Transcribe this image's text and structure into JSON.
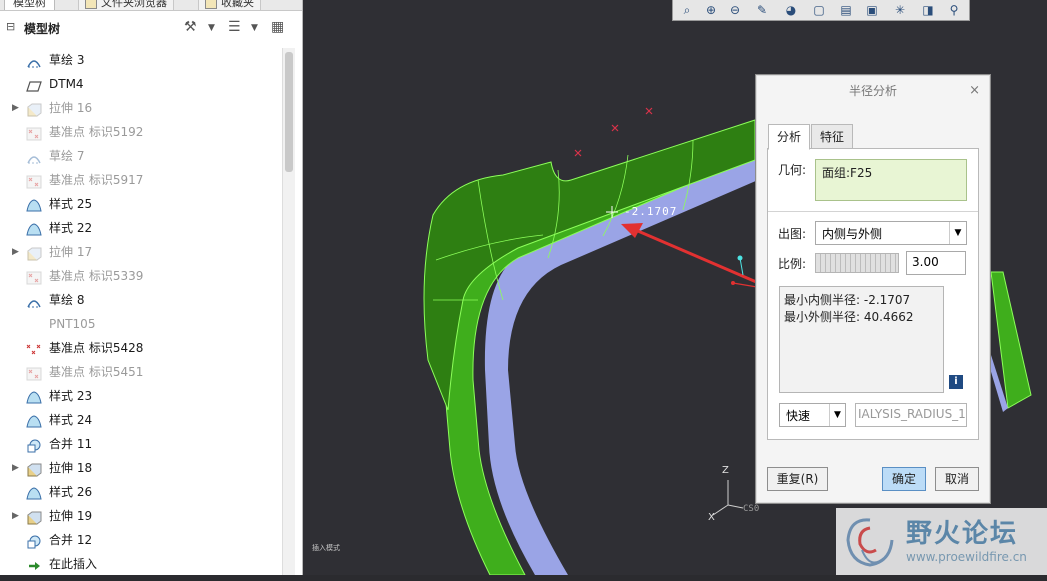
{
  "left_tabs": [
    "模型树",
    "文件夹浏览器",
    "收藏夹"
  ],
  "tree_header": {
    "title": "模型树"
  },
  "tree": [
    {
      "label": "草绘 3",
      "icon": "sketch-icon",
      "dim": false,
      "expand": false
    },
    {
      "label": "DTM4",
      "icon": "datum-plane-icon",
      "dim": false,
      "expand": false
    },
    {
      "label": "拉伸 16",
      "icon": "extrude-icon",
      "dim": true,
      "expand": true
    },
    {
      "label": "基准点 标识5192",
      "icon": "datum-point-icon",
      "dim": true,
      "expand": false
    },
    {
      "label": "草绘 7",
      "icon": "sketch-icon",
      "dim": true,
      "expand": false
    },
    {
      "label": "基准点 标识5917",
      "icon": "datum-point-icon",
      "dim": true,
      "expand": false
    },
    {
      "label": "样式 25",
      "icon": "style-icon",
      "dim": false,
      "expand": false
    },
    {
      "label": "样式 22",
      "icon": "style-icon",
      "dim": false,
      "expand": false
    },
    {
      "label": "拉伸 17",
      "icon": "extrude-icon",
      "dim": true,
      "expand": true
    },
    {
      "label": "基准点 标识5339",
      "icon": "datum-point-icon",
      "dim": true,
      "expand": false
    },
    {
      "label": "草绘 8",
      "icon": "sketch-icon",
      "dim": false,
      "expand": false
    },
    {
      "label": "PNT105",
      "icon": "point-icon",
      "dim": true,
      "expand": false
    },
    {
      "label": "基准点 标识5428",
      "icon": "datum-point-icon",
      "dim": false,
      "expand": false
    },
    {
      "label": "基准点 标识5451",
      "icon": "datum-point-icon",
      "dim": true,
      "expand": false
    },
    {
      "label": "样式 23",
      "icon": "style-icon",
      "dim": false,
      "expand": false
    },
    {
      "label": "样式 24",
      "icon": "style-icon",
      "dim": false,
      "expand": false
    },
    {
      "label": "合并 11",
      "icon": "merge-icon",
      "dim": false,
      "expand": false
    },
    {
      "label": "拉伸 18",
      "icon": "extrude-icon",
      "dim": false,
      "expand": true
    },
    {
      "label": "样式 26",
      "icon": "style-icon",
      "dim": false,
      "expand": false
    },
    {
      "label": "拉伸 19",
      "icon": "extrude-icon",
      "dim": false,
      "expand": true
    },
    {
      "label": "合并 12",
      "icon": "merge-icon",
      "dim": false,
      "expand": false
    },
    {
      "label": "在此插入",
      "icon": "insert-here-icon",
      "dim": false,
      "expand": false
    }
  ],
  "dialog": {
    "title": "半径分析",
    "close": "×",
    "tabs": [
      "分析",
      "特征"
    ],
    "geometry_label": "几何:",
    "geometry_value": "面组:F25",
    "plot_label": "出图:",
    "plot_value": "内侧与外侧",
    "scale_label": "比例:",
    "scale_value": "3.00",
    "results": [
      "最小内侧半径: -2.1707",
      "最小外侧半径: 40.4662"
    ],
    "info": "i",
    "mode_value": "快速",
    "name_value": "IALYSIS_RADIUS_1",
    "reset": "重复(R)",
    "ok": "确定",
    "cancel": "取消"
  },
  "viewport": {
    "annotation": "-2.1707",
    "csys_z": "Z",
    "csys_x": "X",
    "csys_label": "CS0",
    "insert_hint": "插入模式"
  },
  "watermark": {
    "title": "野火论坛",
    "url": "www.proewildfire.cn"
  },
  "colors": {
    "surface_green": "#3fae1c",
    "surface_dark": "#2e7f12",
    "edge": "#8cff5a",
    "blue_face": "#9aa4e6",
    "arrow": "#e23131"
  }
}
